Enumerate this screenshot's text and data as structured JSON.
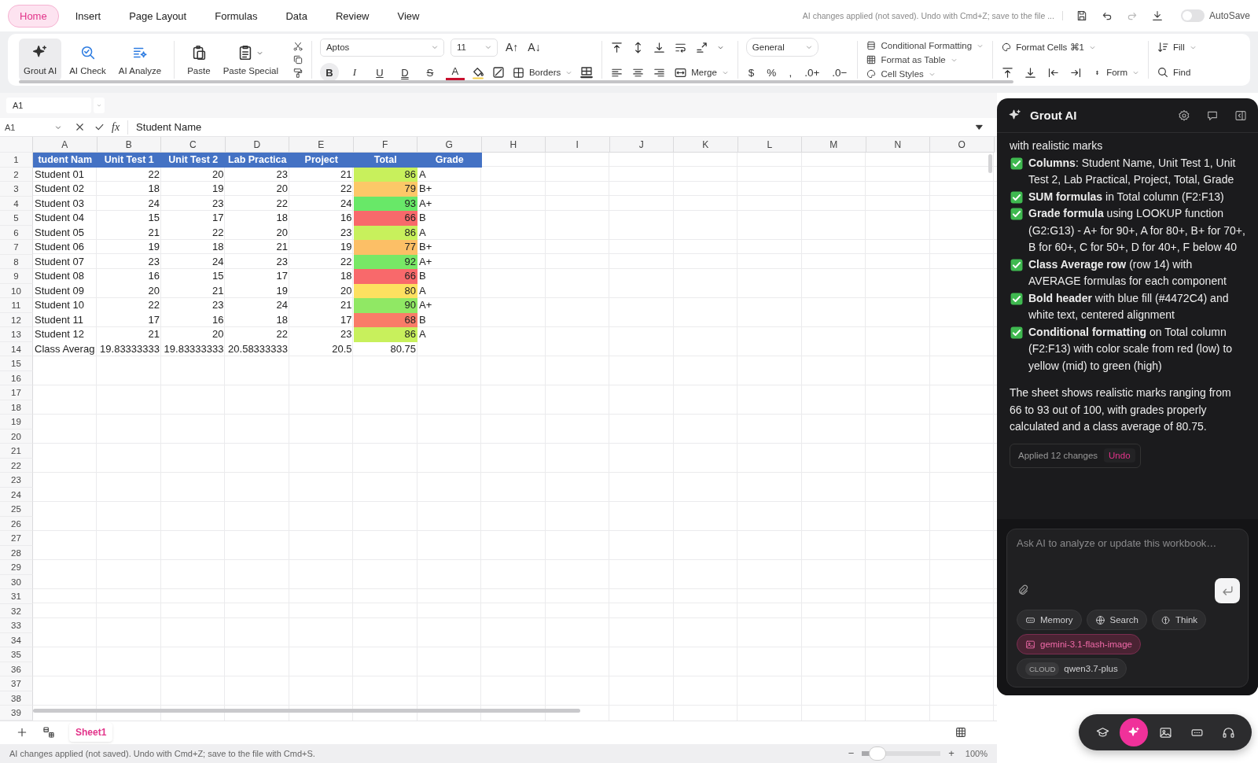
{
  "menu_tabs": [
    {
      "label": "Home",
      "selected": true
    },
    {
      "label": "Insert",
      "selected": false
    },
    {
      "label": "Page Layout",
      "selected": false
    },
    {
      "label": "Formulas",
      "selected": false
    },
    {
      "label": "Data",
      "selected": false
    },
    {
      "label": "Review",
      "selected": false
    },
    {
      "label": "View",
      "selected": false
    }
  ],
  "top_bar": {
    "notice": "AI changes applied (not saved). Undo with Cmd+Z; save to the file ...",
    "autosave": {
      "label": "AutoSave",
      "on": false
    }
  },
  "ribbon": {
    "ai_tools": [
      {
        "label": "Grout AI",
        "selected": true
      },
      {
        "label": "AI Check",
        "selected": false
      },
      {
        "label": "AI Analyze",
        "selected": false
      }
    ],
    "clipboard": [
      "Paste",
      "Paste Special"
    ],
    "font": {
      "name": "Aptos",
      "size": "11"
    },
    "font_size_buttons": [
      "A↑",
      "A↓"
    ],
    "format_buttons": [
      {
        "label": "B",
        "on": true
      },
      {
        "label": "I",
        "on": false
      },
      {
        "label": "U",
        "on": false
      },
      {
        "label": "D",
        "on": false
      },
      {
        "label": "S",
        "on": false
      },
      {
        "label": "A",
        "on": false
      }
    ],
    "borders": "Borders",
    "merge": "Merge",
    "number_format": "General",
    "number_buttons": [
      "$",
      "%",
      ",",
      ".0+",
      ".0−"
    ],
    "styles": [
      "Conditional Formatting",
      "Format as Table",
      "Cell Styles"
    ],
    "format_cells": "Format Cells ⌘1",
    "form": "Form",
    "fill": "Fill",
    "find": "Find"
  },
  "name_box": "A1",
  "formula_bar": {
    "cell": "A1",
    "fx": "fx",
    "value": "Student Name"
  },
  "sheet": {
    "columns": [
      "A",
      "B",
      "C",
      "D",
      "E",
      "F",
      "G",
      "H",
      "I",
      "J",
      "K",
      "L",
      "M",
      "N",
      "O"
    ],
    "rows": [
      {
        "number": "1",
        "kind": "header",
        "cells": [
          "tudent Nam",
          "Unit Test 1",
          "Unit Test 2",
          "Lab Practica",
          "Project",
          "Total",
          "Grade"
        ]
      },
      {
        "number": "2",
        "kind": "data",
        "cells": [
          "Student 01",
          "22",
          "20",
          "23",
          "21",
          "86",
          "A"
        ],
        "color": "#c8f05c"
      },
      {
        "number": "3",
        "kind": "data",
        "cells": [
          "Student 02",
          "18",
          "19",
          "20",
          "22",
          "79",
          "B+"
        ],
        "color": "#fcc868"
      },
      {
        "number": "4",
        "kind": "data",
        "cells": [
          "Student 03",
          "24",
          "23",
          "22",
          "24",
          "93",
          "A+"
        ],
        "color": "#68e868"
      },
      {
        "number": "5",
        "kind": "data",
        "cells": [
          "Student 04",
          "15",
          "17",
          "18",
          "16",
          "66",
          "B"
        ],
        "color": "#f8696b"
      },
      {
        "number": "6",
        "kind": "data",
        "cells": [
          "Student 05",
          "21",
          "22",
          "20",
          "23",
          "86",
          "A"
        ],
        "color": "#c8f05c"
      },
      {
        "number": "7",
        "kind": "data",
        "cells": [
          "Student 06",
          "19",
          "18",
          "21",
          "19",
          "77",
          "B+"
        ],
        "color": "#fcbf66"
      },
      {
        "number": "8",
        "kind": "data",
        "cells": [
          "Student 07",
          "23",
          "24",
          "23",
          "22",
          "92",
          "A+"
        ],
        "color": "#78e866"
      },
      {
        "number": "9",
        "kind": "data",
        "cells": [
          "Student 08",
          "16",
          "15",
          "17",
          "18",
          "66",
          "B"
        ],
        "color": "#f8696b"
      },
      {
        "number": "10",
        "kind": "data",
        "cells": [
          "Student 09",
          "20",
          "21",
          "19",
          "20",
          "80",
          "A"
        ],
        "color": "#fde060"
      },
      {
        "number": "11",
        "kind": "data",
        "cells": [
          "Student 10",
          "22",
          "23",
          "24",
          "21",
          "90",
          "A+"
        ],
        "color": "#90e864"
      },
      {
        "number": "12",
        "kind": "data",
        "cells": [
          "Student 11",
          "17",
          "16",
          "18",
          "17",
          "68",
          "B"
        ],
        "color": "#f97c68"
      },
      {
        "number": "13",
        "kind": "data",
        "cells": [
          "Student 12",
          "21",
          "20",
          "22",
          "23",
          "86",
          "A"
        ],
        "color": "#c8f05c"
      },
      {
        "number": "14",
        "kind": "data",
        "cells": [
          "Class Averag",
          "19.83333333",
          "19.83333333",
          "20.58333333",
          "20.5",
          "80.75"
        ]
      },
      {
        "number": "15"
      },
      {
        "number": "16"
      },
      {
        "number": "17"
      },
      {
        "number": "18"
      },
      {
        "number": "19"
      },
      {
        "number": "20"
      },
      {
        "number": "21"
      },
      {
        "number": "22"
      },
      {
        "number": "23"
      },
      {
        "number": "24"
      },
      {
        "number": "25"
      },
      {
        "number": "26"
      },
      {
        "number": "27"
      },
      {
        "number": "28"
      },
      {
        "number": "29"
      },
      {
        "number": "30"
      },
      {
        "number": "31"
      },
      {
        "number": "32"
      },
      {
        "number": "33"
      },
      {
        "number": "34"
      },
      {
        "number": "35"
      },
      {
        "number": "36"
      },
      {
        "number": "37"
      },
      {
        "number": "38"
      },
      {
        "number": "39"
      }
    ]
  },
  "sheet_tabs": [
    {
      "label": "Sheet1",
      "selected": true
    }
  ],
  "status_bar": {
    "message": "AI changes applied (not saved). Undo with Cmd+Z; save to the file with Cmd+S.",
    "zoom": {
      "minus": "−",
      "plus": "+",
      "level": 0.2,
      "reading": "100%"
    }
  },
  "assistant": {
    "title": "Grout AI",
    "messages": [
      {
        "kind": "text",
        "text": "with realistic marks"
      },
      {
        "kind": "check",
        "text": "**Columns**: Student Name, Unit Test 1, Unit Test 2, Lab Practical, Project, Total, Grade"
      },
      {
        "kind": "check",
        "text": "**SUM formulas** in Total column (F2:F13)"
      },
      {
        "kind": "check",
        "text": "**Grade formula** using LOOKUP function (G2:G13) - A+ for 90+, A for 80+, B+ for 70+, B for 60+, C for 50+, D for 40+, F below 40"
      },
      {
        "kind": "check",
        "text": "**Class Average row** (row 14) with AVERAGE formulas for each component"
      },
      {
        "kind": "check",
        "text": "**Bold header** with blue fill (#4472C4) and white text, centered alignment"
      },
      {
        "kind": "check",
        "text": "**Conditional formatting** on Total column (F2:F13) with color scale from red (low) to yellow (mid) to green (high)"
      },
      {
        "kind": "paragraph",
        "text": "The sheet shows realistic marks ranging from 66 to 93 out of 100, with grades properly calculated and a class average of 80.75."
      }
    ],
    "applied": {
      "label": "Applied 12 changes",
      "action": "Undo"
    },
    "input": {
      "placeholder": "Ask AI to analyze or update this workbook…"
    },
    "options": [
      "Memory",
      "Search",
      "Think"
    ],
    "models": [
      {
        "label": "gemini-3.1-flash-image",
        "selected": true
      },
      {
        "badge": "CLOUD",
        "label": "qwen3.7-plus",
        "selected": false
      }
    ]
  },
  "dock": [
    {
      "selected": false
    },
    {
      "selected": true
    },
    {
      "selected": false
    },
    {
      "selected": false
    },
    {
      "selected": false
    }
  ]
}
